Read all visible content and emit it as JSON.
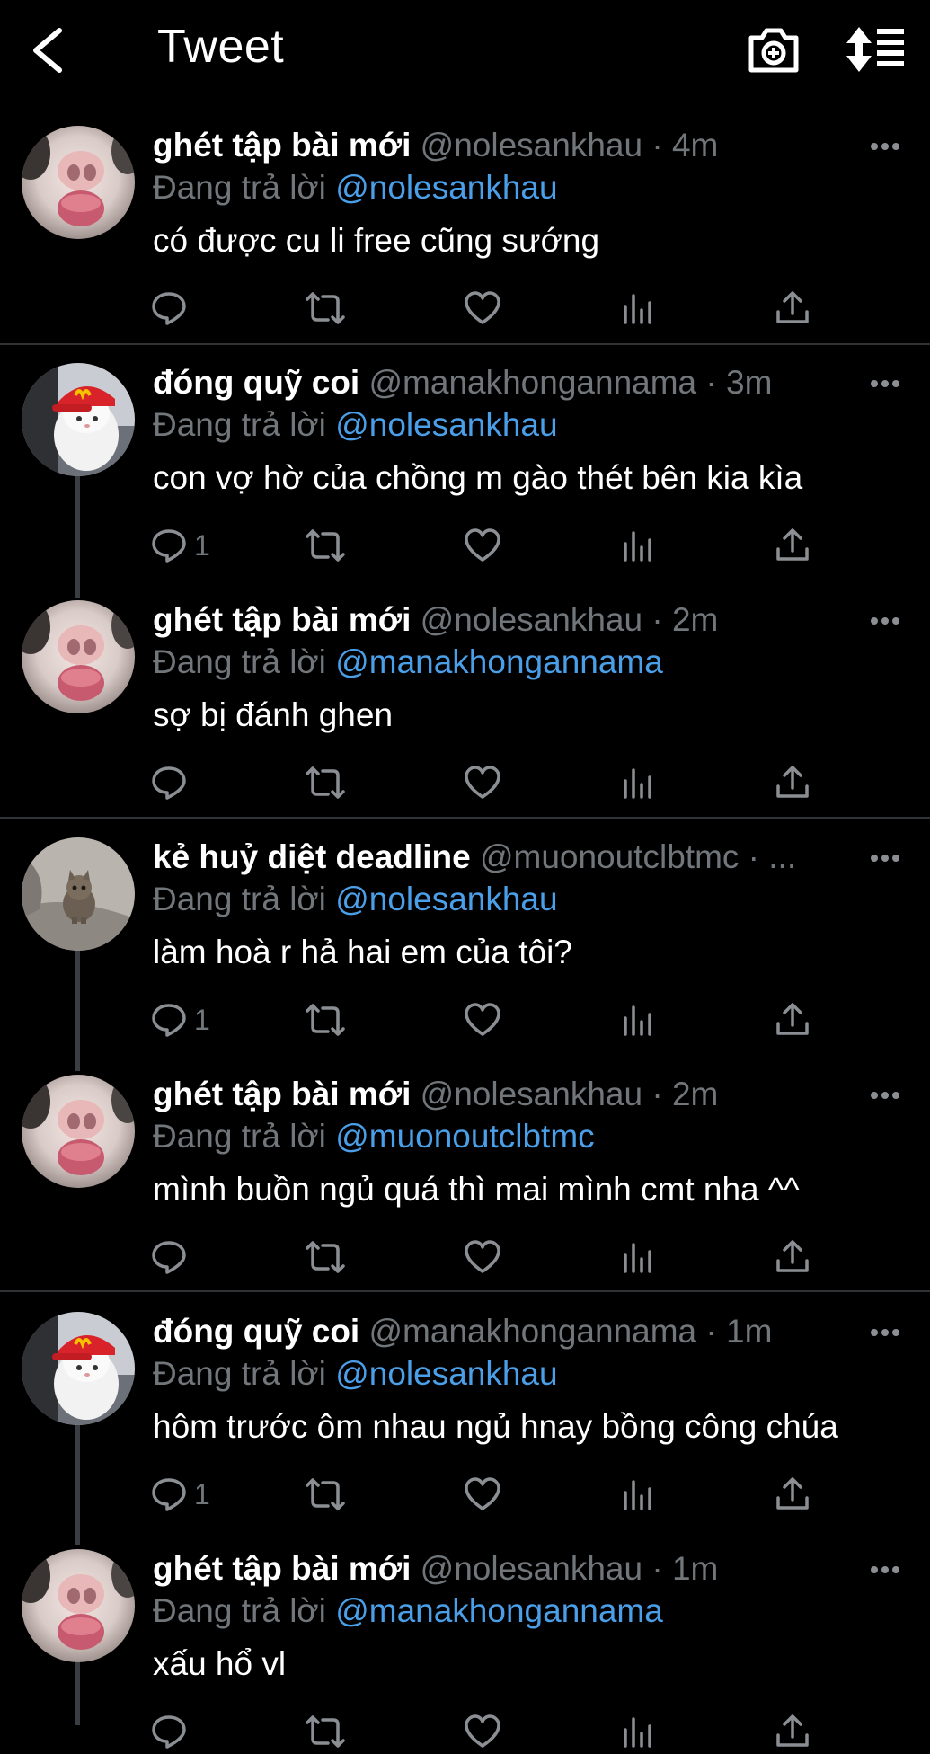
{
  "header": {
    "title": "Tweet",
    "icons": [
      "chevron-left-icon",
      "camera-plus-icon",
      "sort-icon"
    ]
  },
  "reply_prefix": "Đang trả lời",
  "tweets": [
    {
      "name": "ghét tập bài mới",
      "handle": "@nolesankhau",
      "time": "· 4m",
      "reply_to": "@nolesankhau",
      "text": "có được cu li free cũng sướng",
      "reply_count": "",
      "avatar": "bunny"
    },
    {
      "name": "đóng quỹ coi",
      "handle": "@manakhongannama",
      "time": "· 3m",
      "reply_to": "@nolesankhau",
      "text": "con vợ hờ của chồng m gào thét bên kia kìa",
      "reply_count": "1",
      "avatar": "cat-cap"
    },
    {
      "name": "ghét tập bài mới",
      "handle": "@nolesankhau",
      "time": "· 2m",
      "reply_to": "@manakhongannama",
      "text": "sợ bị đánh ghen",
      "reply_count": "",
      "avatar": "bunny"
    },
    {
      "name": "kẻ huỷ diệt deadline",
      "handle": "@muonoutclbtmc",
      "time": "· ...",
      "reply_to": "@nolesankhau",
      "text": "làm hoà r hả hai em của tôi?",
      "reply_count": "1",
      "avatar": "kitten"
    },
    {
      "name": "ghét tập bài mới",
      "handle": "@nolesankhau",
      "time": "· 2m",
      "reply_to": "@muonoutclbtmc",
      "text": "mình buồn ngủ quá thì mai mình cmt nha ^^",
      "reply_count": "",
      "avatar": "bunny"
    },
    {
      "name": "đóng quỹ coi",
      "handle": "@manakhongannama",
      "time": "· 1m",
      "reply_to": "@nolesankhau",
      "text": "hôm trước ôm nhau ngủ hnay bồng công chúa",
      "reply_count": "1",
      "avatar": "cat-cap"
    },
    {
      "name": "ghét tập bài mới",
      "handle": "@nolesankhau",
      "time": "· 1m",
      "reply_to": "@manakhongannama",
      "text": "xấu hổ vl",
      "reply_count": "",
      "avatar": "bunny"
    }
  ],
  "colors": {
    "background": "#000000",
    "mention": "#4a9fe8",
    "muted": "#71767b",
    "divider": "#2f3336"
  }
}
